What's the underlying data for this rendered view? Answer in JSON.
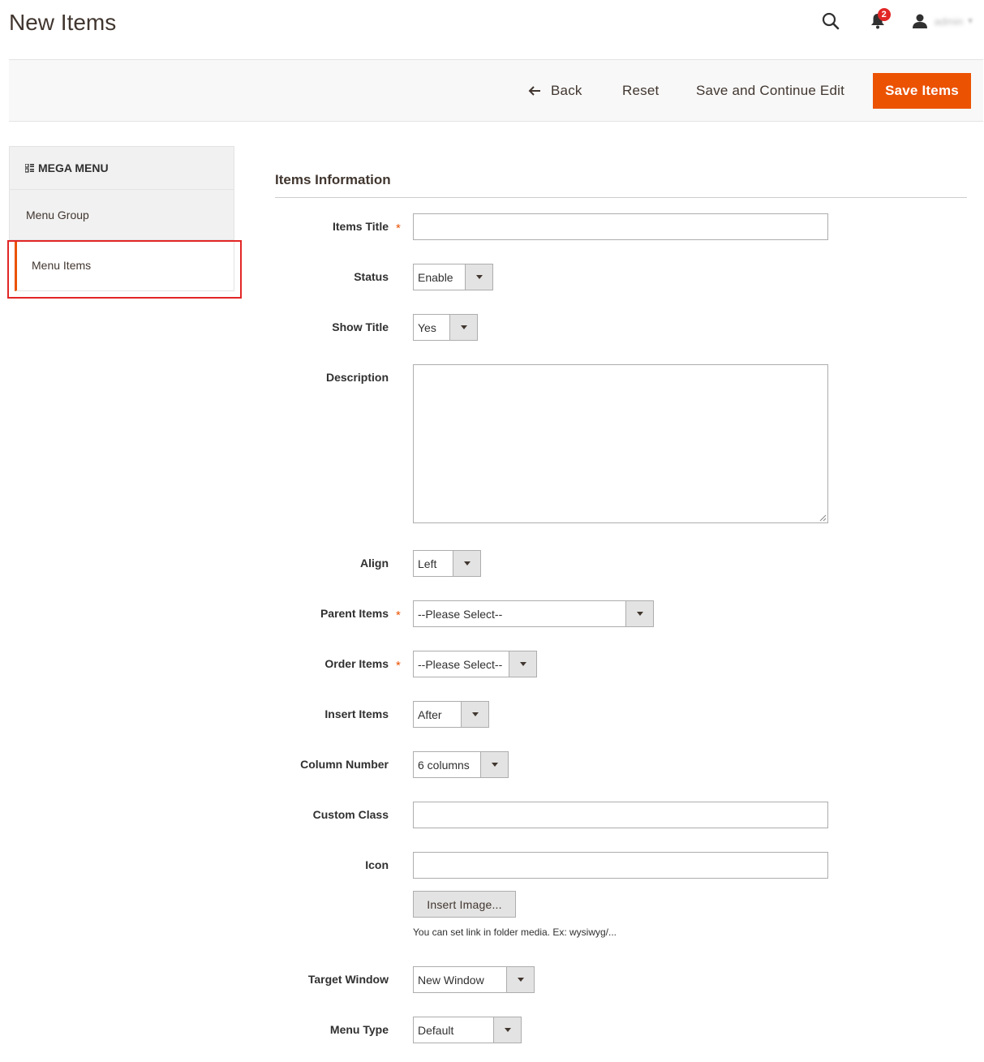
{
  "page": {
    "title": "New Items"
  },
  "header": {
    "notification_count": "2",
    "user_name": "admin",
    "icons": {
      "search": "search-icon",
      "notifications": "bell-icon",
      "user": "user-icon"
    }
  },
  "toolbar": {
    "back_label": "Back",
    "reset_label": "Reset",
    "continue_label": "Save and Continue Edit",
    "save_label": "Save Items"
  },
  "sidebar": {
    "title": "MEGA MENU",
    "items": [
      {
        "label": "Menu Group",
        "active": false
      },
      {
        "label": "Menu Items",
        "active": true
      }
    ]
  },
  "form": {
    "section_title": "Items Information",
    "fields": {
      "items_title": {
        "label": "Items Title",
        "required": "*",
        "value": ""
      },
      "status": {
        "label": "Status",
        "value": "Enable"
      },
      "show_title": {
        "label": "Show Title",
        "value": "Yes"
      },
      "description": {
        "label": "Description",
        "value": ""
      },
      "align": {
        "label": "Align",
        "value": "Left"
      },
      "parent_items": {
        "label": "Parent Items",
        "required": "*",
        "value": "--Please Select--"
      },
      "order_items": {
        "label": "Order Items",
        "required": "*",
        "value": "--Please Select--"
      },
      "insert_items": {
        "label": "Insert Items",
        "value": "After"
      },
      "column_number": {
        "label": "Column Number",
        "value": "6 columns"
      },
      "custom_class": {
        "label": "Custom Class",
        "value": ""
      },
      "icon": {
        "label": "Icon",
        "value": "",
        "button": "Insert Image...",
        "note": "You can set link in folder media. Ex: wysiwyg/..."
      },
      "target_window": {
        "label": "Target Window",
        "value": "New Window"
      },
      "menu_type": {
        "label": "Menu Type",
        "value": "Default"
      }
    }
  },
  "colors": {
    "accent": "#eb5202",
    "highlight": "#e22626",
    "badge": "#e22626"
  }
}
